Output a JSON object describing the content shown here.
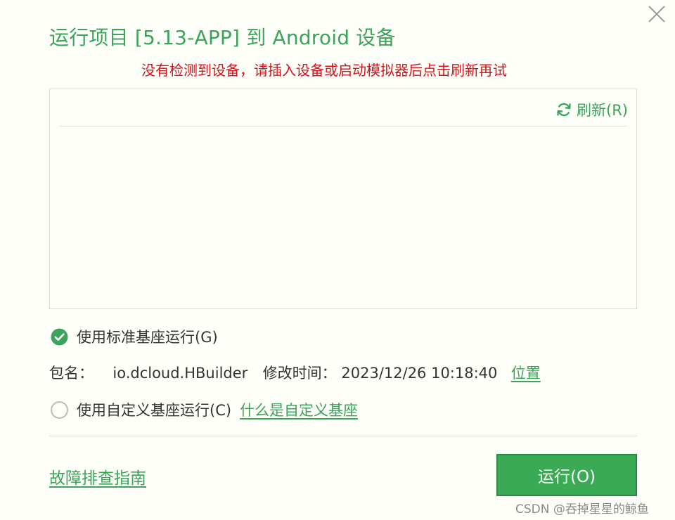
{
  "dialog": {
    "title": "运行项目 [5.13-APP] 到 Android 设备",
    "warning": "没有检测到设备，请插入设备或启动模拟器后点击刷新再试"
  },
  "device_panel": {
    "refresh_label": "刷新(R)"
  },
  "options": {
    "standard_base": {
      "label": "使用标准基座运行(G)",
      "checked": true
    },
    "package": {
      "name_label": "包名：",
      "name_value": "io.dcloud.HBuilder",
      "modified_label": "修改时间：",
      "modified_value": "2023/12/26 10:18:40",
      "location_link": "位置"
    },
    "custom_base": {
      "label": "使用自定义基座运行(C)",
      "checked": false,
      "help_link": "什么是自定义基座"
    }
  },
  "footer": {
    "guide_link": "故障排查指南",
    "run_button": "运行(O)"
  },
  "watermark": "CSDN @吞掉星星的鲸鱼",
  "colors": {
    "accent": "#3ba35a",
    "warning": "#d4141c",
    "button": "#3aaa55"
  },
  "icons": {
    "close": "close-icon",
    "refresh": "refresh-icon",
    "checked": "check-circle-icon",
    "unchecked": "radio-empty-icon"
  }
}
